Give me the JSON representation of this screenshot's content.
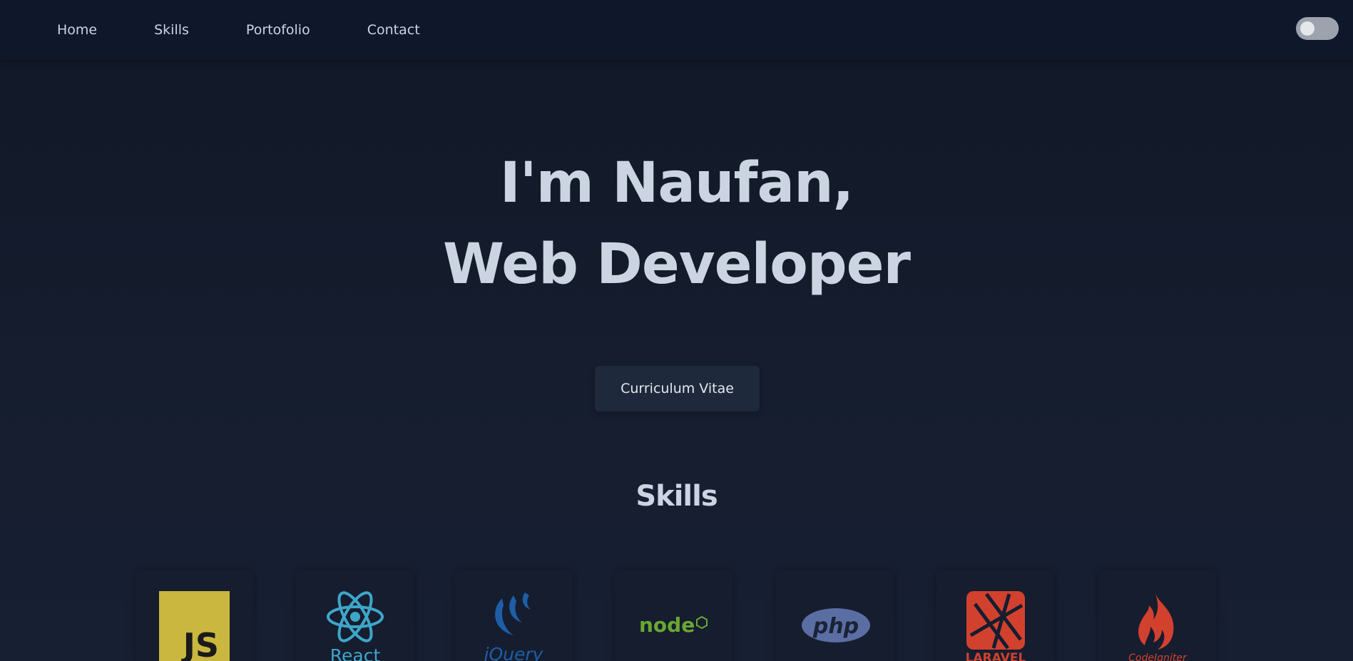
{
  "nav": {
    "items": [
      {
        "label": "Home"
      },
      {
        "label": "Skills"
      },
      {
        "label": "Portofolio"
      },
      {
        "label": "Contact"
      }
    ],
    "theme_toggle": {
      "state": "off"
    }
  },
  "hero": {
    "line1": "I'm Naufan,",
    "line2": "Web Developer",
    "cta_label": "Curriculum Vitae"
  },
  "skills": {
    "heading": "Skills",
    "items": [
      {
        "name": "JavaScript",
        "logo_text": "JS",
        "icon": "javascript-icon",
        "color": "#c9b73f"
      },
      {
        "name": "React",
        "logo_text": "React",
        "icon": "react-icon",
        "color": "#3fa6c9"
      },
      {
        "name": "jQuery",
        "logo_text": "jQuery",
        "icon": "jquery-icon",
        "color": "#1d5ea6"
      },
      {
        "name": "Node.js",
        "logo_text": "node",
        "icon": "nodejs-icon",
        "color": "#6aa832"
      },
      {
        "name": "PHP",
        "logo_text": "php",
        "icon": "php-icon",
        "color": "#5a6ea3"
      },
      {
        "name": "Laravel",
        "logo_text": "LARAVEL",
        "icon": "laravel-icon",
        "color": "#d2412e"
      },
      {
        "name": "CodeIgniter",
        "logo_text": "CodeIgniter",
        "icon": "codeigniter-icon",
        "color": "#d2412e"
      }
    ]
  }
}
